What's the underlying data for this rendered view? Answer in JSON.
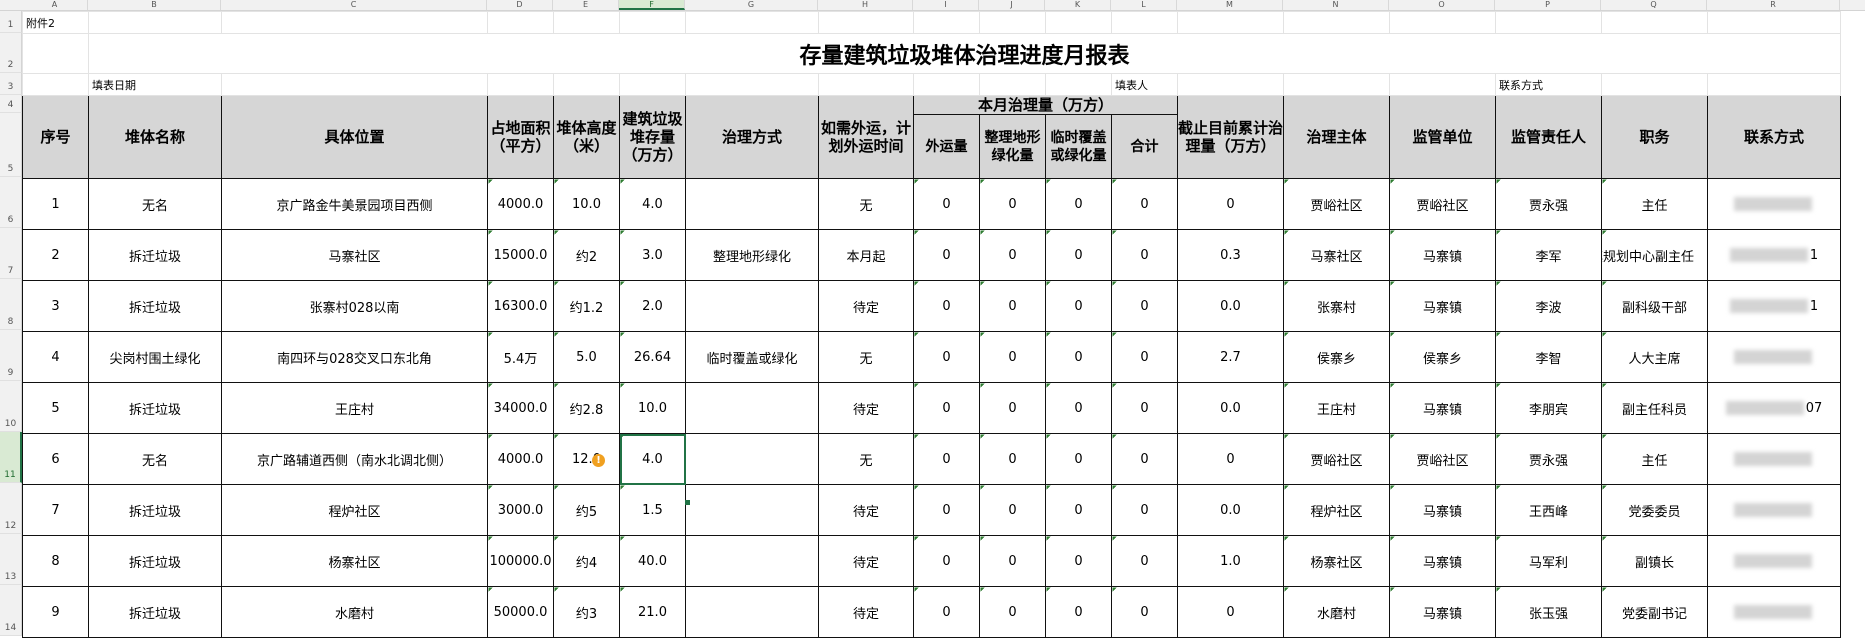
{
  "columns": [
    "A",
    "B",
    "C",
    "D",
    "E",
    "F",
    "G",
    "H",
    "I",
    "J",
    "K",
    "L",
    "M",
    "N",
    "O",
    "P",
    "Q",
    "R"
  ],
  "selected_column": "F",
  "row_numbers": [
    "1",
    "2",
    "3",
    "4",
    "5",
    "6",
    "7",
    "8",
    "9",
    "10",
    "11",
    "12",
    "13",
    "14"
  ],
  "selected_row": "11",
  "sheet": {
    "attachment": "附件2",
    "title": "存量建筑垃圾堆体治理进度月报表",
    "fill_date_label": "填表日期",
    "filler_label": "填表人",
    "contact_label": "联系方式"
  },
  "headers": {
    "seq": "序号",
    "name": "堆体名称",
    "location": "具体位置",
    "area": "占地面积（平方）",
    "height": "堆体高度（米）",
    "stock": "建筑垃圾堆存量（万方）",
    "method": "治理方式",
    "transport_plan": "如需外运，计划外运时间",
    "monthly_group": "本月治理量（万方）",
    "out": "外运量",
    "terrain": "整理地形绿化量",
    "cover": "临时覆盖或绿化量",
    "total": "合计",
    "cumulative": "截止目前累计治理量（万方）",
    "subject": "治理主体",
    "supervisor": "监管单位",
    "responsible": "监管责任人",
    "position": "职务",
    "contact": "联系方式"
  },
  "rows": [
    {
      "seq": "1",
      "name": "无名",
      "location": "京广路金牛美景园项目西侧",
      "area": "4000.0",
      "height": "10.0",
      "stock": "4.0",
      "method": "",
      "plan": "无",
      "out": "0",
      "terrain": "0",
      "cover": "0",
      "total": "0",
      "cum": "0",
      "subject": "贾峪社区",
      "supervisor": "贾峪社区",
      "resp": "贾永强",
      "position": "主任",
      "contact": ""
    },
    {
      "seq": "2",
      "name": "拆迁垃圾",
      "location": "马寨社区",
      "area": "15000.0",
      "height": "约2",
      "stock": "3.0",
      "method": "整理地形绿化",
      "plan": "本月起",
      "out": "0",
      "terrain": "0",
      "cover": "0",
      "total": "0",
      "cum": "0.3",
      "subject": "马寨社区",
      "supervisor": "马寨镇",
      "resp": "李军",
      "position": "镇规划中心副主任",
      "contact": "1"
    },
    {
      "seq": "3",
      "name": "拆迁垃圾",
      "location": "张寨村028以南",
      "area": "16300.0",
      "height": "约1.2",
      "stock": "2.0",
      "method": "",
      "plan": "待定",
      "out": "0",
      "terrain": "0",
      "cover": "0",
      "total": "0",
      "cum": "0.0",
      "subject": "张寨村",
      "supervisor": "马寨镇",
      "resp": "李波",
      "position": "副科级干部",
      "contact": "1"
    },
    {
      "seq": "4",
      "name": "尖岗村围土绿化",
      "location": "南四环与028交叉口东北角",
      "area": "5.4万",
      "height": "5.0",
      "stock": "26.64",
      "method": "临时覆盖或绿化",
      "plan": "无",
      "out": "0",
      "terrain": "0",
      "cover": "0",
      "total": "0",
      "cum": "2.7",
      "subject": "侯寨乡",
      "supervisor": "侯寨乡",
      "resp": "李智",
      "position": "人大主席",
      "contact": ""
    },
    {
      "seq": "5",
      "name": "拆迁垃圾",
      "location": "王庄村",
      "area": "34000.0",
      "height": "约2.8",
      "stock": "10.0",
      "method": "",
      "plan": "待定",
      "out": "0",
      "terrain": "0",
      "cover": "0",
      "total": "0",
      "cum": "0.0",
      "subject": "王庄村",
      "supervisor": "马寨镇",
      "resp": "李朋宾",
      "position": "副主任科员",
      "contact": "07"
    },
    {
      "seq": "6",
      "name": "无名",
      "location": "京广路辅道西侧（南水北调北侧）",
      "area": "4000.0",
      "height": "12.0",
      "stock": "4.0",
      "method": "",
      "plan": "无",
      "out": "0",
      "terrain": "0",
      "cover": "0",
      "total": "0",
      "cum": "0",
      "subject": "贾峪社区",
      "supervisor": "贾峪社区",
      "resp": "贾永强",
      "position": "主任",
      "contact": ""
    },
    {
      "seq": "7",
      "name": "拆迁垃圾",
      "location": "程炉社区",
      "area": "3000.0",
      "height": "约5",
      "stock": "1.5",
      "method": "",
      "plan": "待定",
      "out": "0",
      "terrain": "0",
      "cover": "0",
      "total": "0",
      "cum": "0.0",
      "subject": "程炉社区",
      "supervisor": "马寨镇",
      "resp": "王西峰",
      "position": "党委委员",
      "contact": ""
    },
    {
      "seq": "8",
      "name": "拆迁垃圾",
      "location": "杨寨社区",
      "area": "100000.0",
      "height": "约4",
      "stock": "40.0",
      "method": "",
      "plan": "待定",
      "out": "0",
      "terrain": "0",
      "cover": "0",
      "total": "0",
      "cum": "1.0",
      "subject": "杨寨社区",
      "supervisor": "马寨镇",
      "resp": "马军利",
      "position": "副镇长",
      "contact": ""
    },
    {
      "seq": "9",
      "name": "拆迁垃圾",
      "location": "水磨村",
      "area": "50000.0",
      "height": "约3",
      "stock": "21.0",
      "method": "",
      "plan": "待定",
      "out": "0",
      "terrain": "0",
      "cover": "0",
      "total": "0",
      "cum": "0",
      "subject": "水磨村",
      "supervisor": "马寨镇",
      "resp": "张玉强",
      "position": "党委副书记",
      "contact": ""
    }
  ],
  "warning_icon": "!"
}
